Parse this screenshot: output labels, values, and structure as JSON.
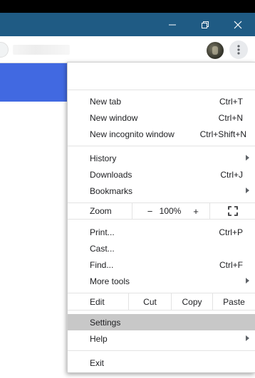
{
  "window": {
    "minimize_icon": "minimize-icon",
    "restore_icon": "restore-icon",
    "close_icon": "close-icon",
    "titlebar_color": "#1f5b84"
  },
  "toolbar": {
    "menu_icon": "three-dots-vertical-icon"
  },
  "menu": {
    "group1": [
      {
        "label": "New tab",
        "shortcut": "Ctrl+T"
      },
      {
        "label": "New window",
        "shortcut": "Ctrl+N"
      },
      {
        "label": "New incognito window",
        "shortcut": "Ctrl+Shift+N"
      }
    ],
    "group2": [
      {
        "label": "History",
        "shortcut": ""
      },
      {
        "label": "Downloads",
        "shortcut": "Ctrl+J"
      },
      {
        "label": "Bookmarks",
        "shortcut": ""
      }
    ],
    "zoom": {
      "label": "Zoom",
      "minus": "−",
      "value": "100%",
      "plus": "+"
    },
    "group3": [
      {
        "label": "Print...",
        "shortcut": "Ctrl+P"
      },
      {
        "label": "Cast...",
        "shortcut": ""
      },
      {
        "label": "Find...",
        "shortcut": "Ctrl+F"
      },
      {
        "label": "More tools",
        "shortcut": ""
      }
    ],
    "edit": {
      "label": "Edit",
      "cut": "Cut",
      "copy": "Copy",
      "paste": "Paste"
    },
    "group4": [
      {
        "label": "Settings",
        "shortcut": ""
      },
      {
        "label": "Help",
        "shortcut": ""
      }
    ],
    "exit": {
      "label": "Exit"
    },
    "highlight_color": "#c8c8c8"
  },
  "page": {
    "banner_color": "#4169e1"
  }
}
